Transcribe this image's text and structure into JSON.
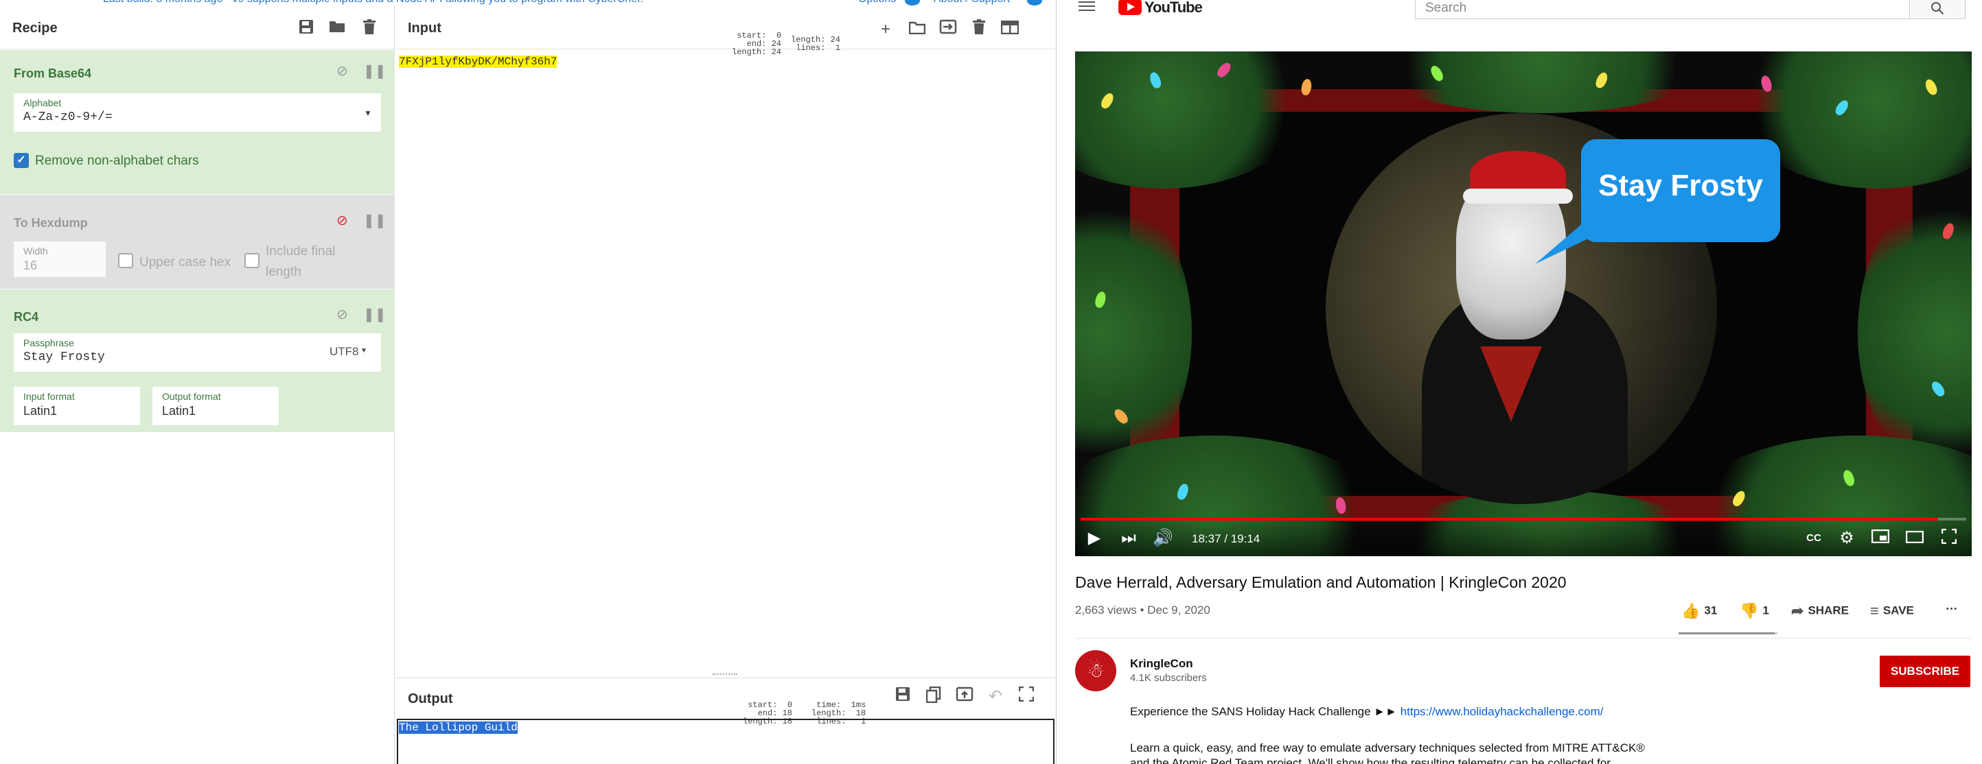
{
  "top_strip": {
    "left_text": "Last build: 8 months ago - v9 supports multiple inputs and a Node API allowing you to program with CyberChef!",
    "options": "Options",
    "about": "About / Support"
  },
  "recipe": {
    "title": "Recipe",
    "operations": [
      {
        "name": "From Base64",
        "enabled": true,
        "alphabet_label": "Alphabet",
        "alphabet_value": "A-Za-z0-9+/=",
        "remove_label": "Remove non-alphabet chars",
        "remove_checked": true
      },
      {
        "name": "To Hexdump",
        "enabled": false,
        "width_label": "Width",
        "width_value": "16",
        "upper_label": "Upper case hex",
        "final_label_1": "Include final",
        "final_label_2": "length"
      },
      {
        "name": "RC4",
        "enabled": true,
        "passphrase_label": "Passphrase",
        "passphrase_value": "Stay Frosty",
        "encoding": "UTF8",
        "input_format_label": "Input format",
        "input_format_value": "Latin1",
        "output_format_label": "Output format",
        "output_format_value": "Latin1"
      }
    ]
  },
  "input": {
    "title": "Input",
    "stats": {
      "start": "start:  0",
      "end": "end: 24",
      "length1": "length: 24",
      "length2": "length: 24",
      "lines": "lines:  1"
    },
    "text": "7FXjP1lyfKbyDK/MChyf36h7"
  },
  "output": {
    "title": "Output",
    "stats": {
      "start": "start:  0",
      "end": "end: 18",
      "length1": "length: 18",
      "time": "time:  1ms",
      "length2": "length:  18",
      "lines": "lines:   1"
    },
    "text": "The Lollipop Guild"
  },
  "youtube": {
    "logo_text": "YouTube",
    "search_placeholder": "Search",
    "video_bubble_text": "Stay Frosty",
    "time": "18:37 / 19:14",
    "progress_fraction": 0.968,
    "title": "Dave Herrald, Adversary Emulation and Automation | KringleCon 2020",
    "meta": "2,663 views • Dec 9, 2020",
    "likes": "31",
    "dislikes": "1",
    "like_ratio": 0.969,
    "share": "SHARE",
    "save": "SAVE",
    "channel_name": "KringleCon",
    "channel_subs": "4.1K subscribers",
    "subscribe": "SUBSCRIBE",
    "desc_line1": "Experience the SANS Holiday Hack Challenge ►► ",
    "desc_link": "https://www.holidayhackchallenge.com/",
    "desc_line2": "Learn a quick, easy, and free way to emulate adversary techniques selected from MITRE ATT&CK®",
    "desc_line3": "and the Atomic Red Team project. We'll show how the resulting telemetry can be collected for"
  },
  "colors": {
    "recipe_green": "#dbeed5",
    "recipe_disabled": "#e0e0e0",
    "input_highlight": "#fff200",
    "output_selection": "#2a6fd6",
    "youtube_red": "#ff0000",
    "bubble_blue": "#1b94e8"
  }
}
